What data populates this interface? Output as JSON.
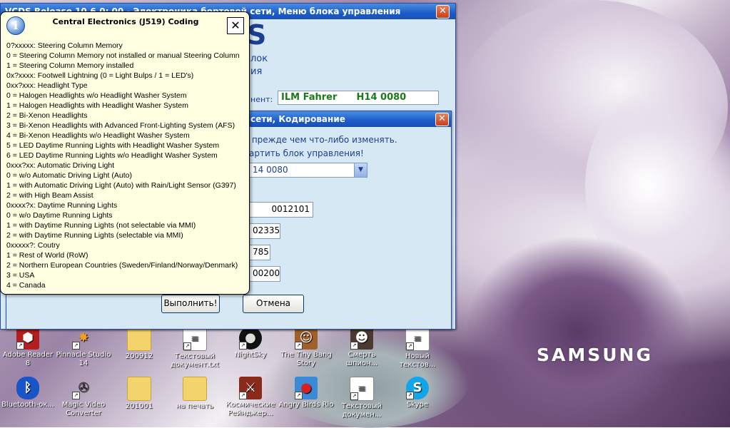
{
  "main_window": {
    "title": "VCDS Release 10.6.0: 00 - Электроника бортовой сети, Меню блока управления",
    "partial_s": "S",
    "label_line1": "лок",
    "label_line2": "ия",
    "component_label": "нент:",
    "component_value": "ILM Fahrer      H14 0080"
  },
  "coding_dialog": {
    "title": "сети, Кодирование",
    "warning_line1": " прежде чем что-либо изменять.",
    "warning_line2": "артить блок управления!",
    "select_value": "14 0080",
    "field1": "0012101",
    "field2": "02335",
    "field3": "785",
    "field4": "00200",
    "execute_label": "Выполнить!",
    "cancel_label": "Отмена"
  },
  "tooltip": {
    "title": "Central Electronics (J519) Coding",
    "lines": [
      "0?xxxxx: Steering Column Memory",
      "0 = Steering Column Memory not installed or manual Steering Column",
      "1 = Steering Column Memory installed",
      "0x?xxxx: Footwell Lightning (0 = Light Bulps / 1 = LED's)",
      "0xx?xxx: Headlight Type",
      "0 = Halogen Headlights w/o Headlight Washer System",
      "1 = Halogen Headlights with Headlight Washer System",
      "2 = Bi-Xenon Headlights",
      "3 = Bi-Xenon Headlights with Advanced Front-Lighting System (AFS)",
      "4 = Bi-Xenon Headlights w/o Headlight Washer System",
      "5 = LED Daytime Running Lights with Headlight Washer System",
      "6 = LED Daytime Running Lights w/o Headlight Washer System",
      "0xxx?xx: Automatic Driving Light",
      "0 = w/o Automatic Driving Light (Auto)",
      "1 = with Automatic Driving Light (Auto) with Rain/Light Sensor (G397)",
      "2 = with High Beam Assist",
      "0xxxx?x: Daytime Running Lights",
      "0 = w/o Daytime Running Lights",
      "1 = with Daytime Running Lights (not selectable via MMI)",
      "2 = with Daytime Running Lights (selectable via MMI)",
      "0xxxxx?: Coutry",
      "1 = Rest of World (RoW)",
      "2 = Northern European Countries (Sweden/Finland/Norway/Denmark)",
      "3 = USA",
      "4 = Canada"
    ]
  },
  "desktop": {
    "brand": "SAMSUNG",
    "icons_row1": [
      {
        "label": "Adobe Reader 8",
        "icon": "pdf-icon"
      },
      {
        "label": "Pinnacle Studio 14",
        "icon": "star-icon"
      },
      {
        "label": "200912",
        "icon": "folder-icon"
      },
      {
        "label": "Текстовый документ.txt",
        "icon": "text-file-icon"
      },
      {
        "label": "NightSky",
        "icon": "night-sky-icon"
      },
      {
        "label": "The Tiny Bang Story",
        "icon": "game-icon"
      },
      {
        "label": "Смерть шпион...",
        "icon": "game-icon"
      },
      {
        "label": "Новый текстов...",
        "icon": "text-file-icon"
      }
    ],
    "icons_row2": [
      {
        "label": "Bluetooth-ок...",
        "icon": "bluetooth-icon"
      },
      {
        "label": "Magic Video Converter",
        "icon": "film-reel-icon"
      },
      {
        "label": "201001",
        "icon": "folder-icon"
      },
      {
        "label": "на печать",
        "icon": "folder-icon"
      },
      {
        "label": "Космические Рейнджер...",
        "icon": "game-icon"
      },
      {
        "label": "Angry Birds Rio",
        "icon": "angry-bird-icon"
      },
      {
        "label": "Текстовый докумен...",
        "icon": "text-file-icon"
      },
      {
        "label": "Skype",
        "icon": "skype-icon"
      }
    ]
  },
  "colors": {
    "titlebar": "#1c5cc8",
    "window_bg": "#d6e8f3",
    "tooltip_bg": "#ffffe1",
    "green_text": "#1a7a1a",
    "blue_text": "#1c3f94"
  }
}
